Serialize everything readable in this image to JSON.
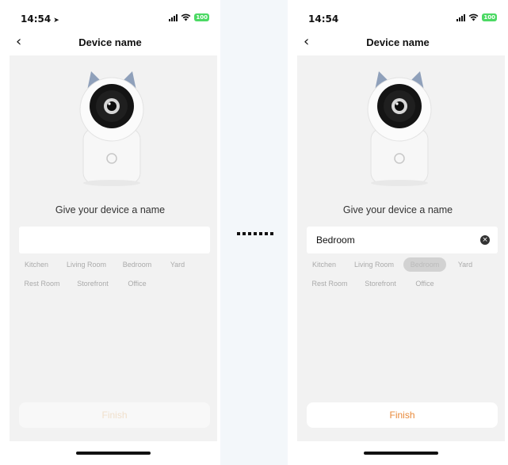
{
  "left": {
    "status": {
      "time": "14:54",
      "battery": "100"
    },
    "title": "Device name",
    "prompt": "Give your device a name",
    "input_value": "",
    "chips": [
      "Kitchen",
      "Living Room",
      "Bedroom",
      "Yard",
      "Rest Room",
      "Storefront",
      "Office"
    ],
    "finish_label": "Finish",
    "finish_state": "disabled"
  },
  "right": {
    "status": {
      "time": "14:54",
      "battery": "100"
    },
    "title": "Device name",
    "prompt": "Give your device a name",
    "input_value": "Bedroom",
    "chips": [
      "Kitchen",
      "Living Room",
      "Bedroom",
      "Yard",
      "Rest Room",
      "Storefront",
      "Office"
    ],
    "selected_chip": "Bedroom",
    "finish_label": "Finish",
    "finish_state": "enabled"
  },
  "colors": {
    "accent": "#e8893a",
    "screen_bg": "#f2f2f2",
    "battery": "#4cd964"
  }
}
